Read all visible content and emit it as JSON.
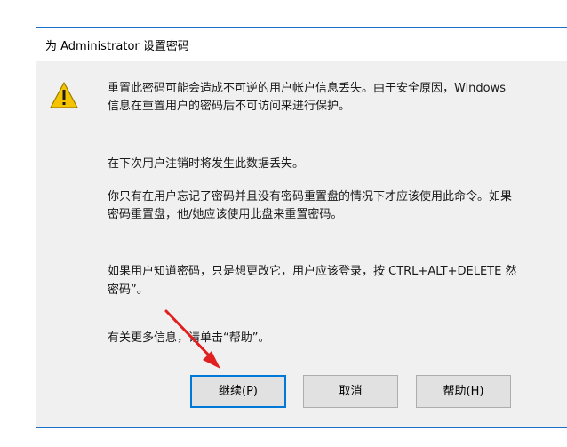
{
  "window": {
    "title": "为 Administrator 设置密码"
  },
  "icon": "warning-icon",
  "messages": {
    "p1_line1": "重置此密码可能会造成不可逆的用户帐户信息丢失。由于安全原因，Windows",
    "p1_line2": "信息在重置用户的密码后不可访问来进行保护。",
    "p2": "在下次用户注销时将发生此数据丢失。",
    "p3_line1": "你只有在用户忘记了密码并且没有密码重置盘的情况下才应该使用此命令。如果",
    "p3_line2": "密码重置盘，他/她应该使用此盘来重置密码。",
    "p4_line1": "如果用户知道密码，只是想更改它，用户应该登录，按 CTRL+ALT+DELETE 然",
    "p4_line2": "密码”。",
    "p5": "有关更多信息，请单击“帮助”。"
  },
  "buttons": {
    "continue": "继续(P)",
    "cancel": "取消",
    "help": "帮助(H)"
  },
  "colors": {
    "accent": "#0078d7",
    "annotation_arrow": "#e02020",
    "warning": "#f5c400"
  }
}
